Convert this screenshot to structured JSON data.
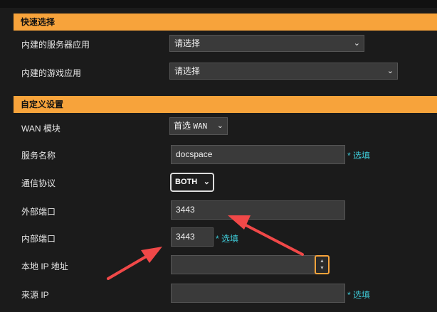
{
  "quick": {
    "title": "快速选择",
    "server_label": "内建的服务器应用",
    "server_value": "请选择",
    "game_label": "内建的游戏应用",
    "game_value": "请选择"
  },
  "custom": {
    "title": "自定义设置",
    "wan_label": "WAN 模块",
    "wan_value_prefix": "首选",
    "wan_value": "WAN",
    "service_label": "服务名称",
    "service_value": "docspace",
    "optional": "* 选填",
    "protocol_label": "通信协议",
    "protocol_value": "BOTH",
    "external_port_label": "外部端口",
    "external_port_value": "3443",
    "internal_port_label": "内部端口",
    "internal_port_value": "3443",
    "local_ip_label": "本地 IP 地址",
    "local_ip_value": "",
    "source_ip_label": "来源 IP",
    "source_ip_value": ""
  },
  "colors": {
    "accent": "#f7a33b",
    "optional_text": "#3ec9d6",
    "annotation_arrow": "#f04848"
  }
}
